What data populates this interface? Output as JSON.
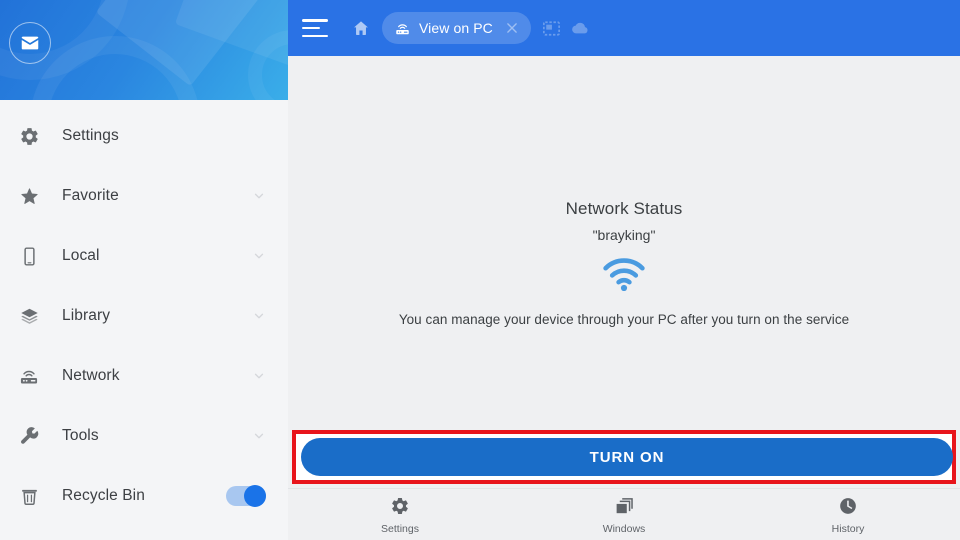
{
  "sidebar": {
    "avatar_icon": "mail-envelope-icon",
    "items": [
      {
        "id": "settings",
        "label": "Settings",
        "icon": "gear-icon",
        "accessory": "none"
      },
      {
        "id": "favorite",
        "label": "Favorite",
        "icon": "star-icon",
        "accessory": "chevron-down"
      },
      {
        "id": "local",
        "label": "Local",
        "icon": "phone-icon",
        "accessory": "chevron-down"
      },
      {
        "id": "library",
        "label": "Library",
        "icon": "layers-icon",
        "accessory": "chevron-down"
      },
      {
        "id": "network",
        "label": "Network",
        "icon": "router-icon",
        "accessory": "chevron-down"
      },
      {
        "id": "tools",
        "label": "Tools",
        "icon": "wrench-icon",
        "accessory": "chevron-down"
      },
      {
        "id": "recycle-bin",
        "label": "Recycle Bin",
        "icon": "trash-icon",
        "accessory": "toggle",
        "toggle_on": true
      }
    ]
  },
  "toolbar": {
    "menu_icon": "hamburger-menu-icon",
    "home_icon": "home-icon",
    "tab": {
      "label": "View on PC",
      "icon": "router-icon",
      "close_icon": "close-icon",
      "active": true
    },
    "capture_icon": "screen-capture-icon",
    "cloud_icon": "cloud-icon"
  },
  "main": {
    "title": "Network Status",
    "ssid": "\"brayking\"",
    "status_icon": "wifi-icon",
    "description": "You can manage your device through your PC after you turn on the service"
  },
  "action": {
    "label": "TURN ON",
    "highlighted": true
  },
  "bottom_nav": {
    "items": [
      {
        "id": "settings",
        "label": "Settings",
        "icon": "gear-icon"
      },
      {
        "id": "windows",
        "label": "Windows",
        "icon": "windows-stack-icon"
      },
      {
        "id": "history",
        "label": "History",
        "icon": "clock-icon"
      }
    ]
  },
  "colors": {
    "brand_blue": "#2a72e5",
    "button_blue": "#1a6dc8",
    "accent_blue": "#1a73e8",
    "wifi_blue": "#4a9be0",
    "highlight_red": "#e8151c",
    "sidebar_bg": "#f4f5f7",
    "content_bg": "#eff0f2"
  }
}
